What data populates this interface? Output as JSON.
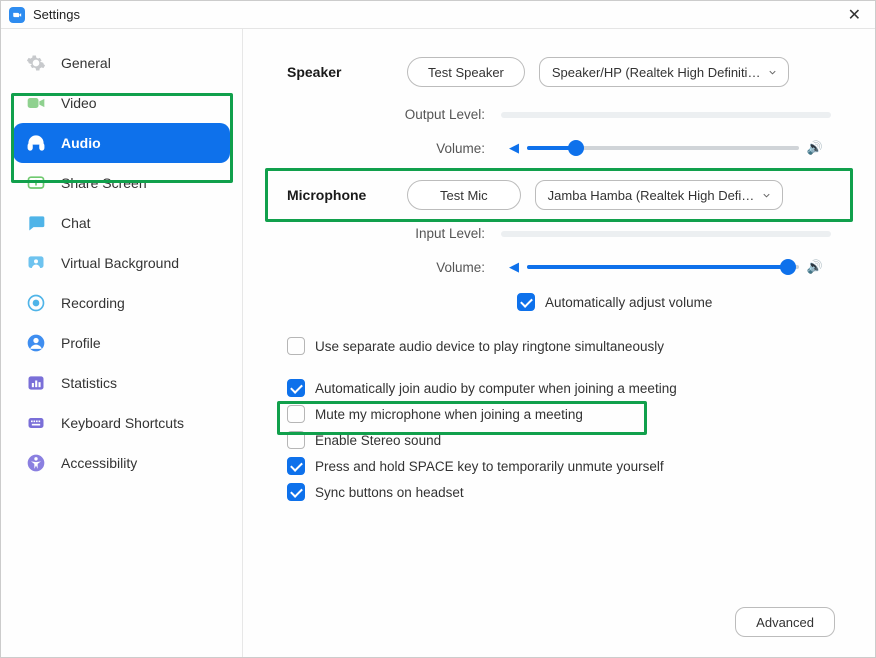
{
  "window": {
    "title": "Settings"
  },
  "sidebar": {
    "items": [
      {
        "label": "General"
      },
      {
        "label": "Video"
      },
      {
        "label": "Audio"
      },
      {
        "label": "Share Screen"
      },
      {
        "label": "Chat"
      },
      {
        "label": "Virtual Background"
      },
      {
        "label": "Recording"
      },
      {
        "label": "Profile"
      },
      {
        "label": "Statistics"
      },
      {
        "label": "Keyboard Shortcuts"
      },
      {
        "label": "Accessibility"
      }
    ]
  },
  "speaker": {
    "section": "Speaker",
    "test_btn": "Test Speaker",
    "device": "Speaker/HP (Realtek High Definiti…",
    "output_label": "Output Level:",
    "volume_label": "Volume:"
  },
  "microphone": {
    "section": "Microphone",
    "test_btn": "Test Mic",
    "device": "Jamba Hamba (Realtek High Defi…",
    "input_label": "Input Level:",
    "volume_label": "Volume:",
    "auto_adjust": "Automatically adjust volume"
  },
  "options": {
    "separate_ringtone": "Use separate audio device to play ringtone simultaneously",
    "auto_join": "Automatically join audio by computer when joining a meeting",
    "mute_on_join": "Mute my microphone when joining a meeting",
    "stereo": "Enable Stereo sound",
    "space_unmute": "Press and hold SPACE key to temporarily unmute yourself",
    "sync_headset": "Sync buttons on headset"
  },
  "advanced_btn": "Advanced"
}
